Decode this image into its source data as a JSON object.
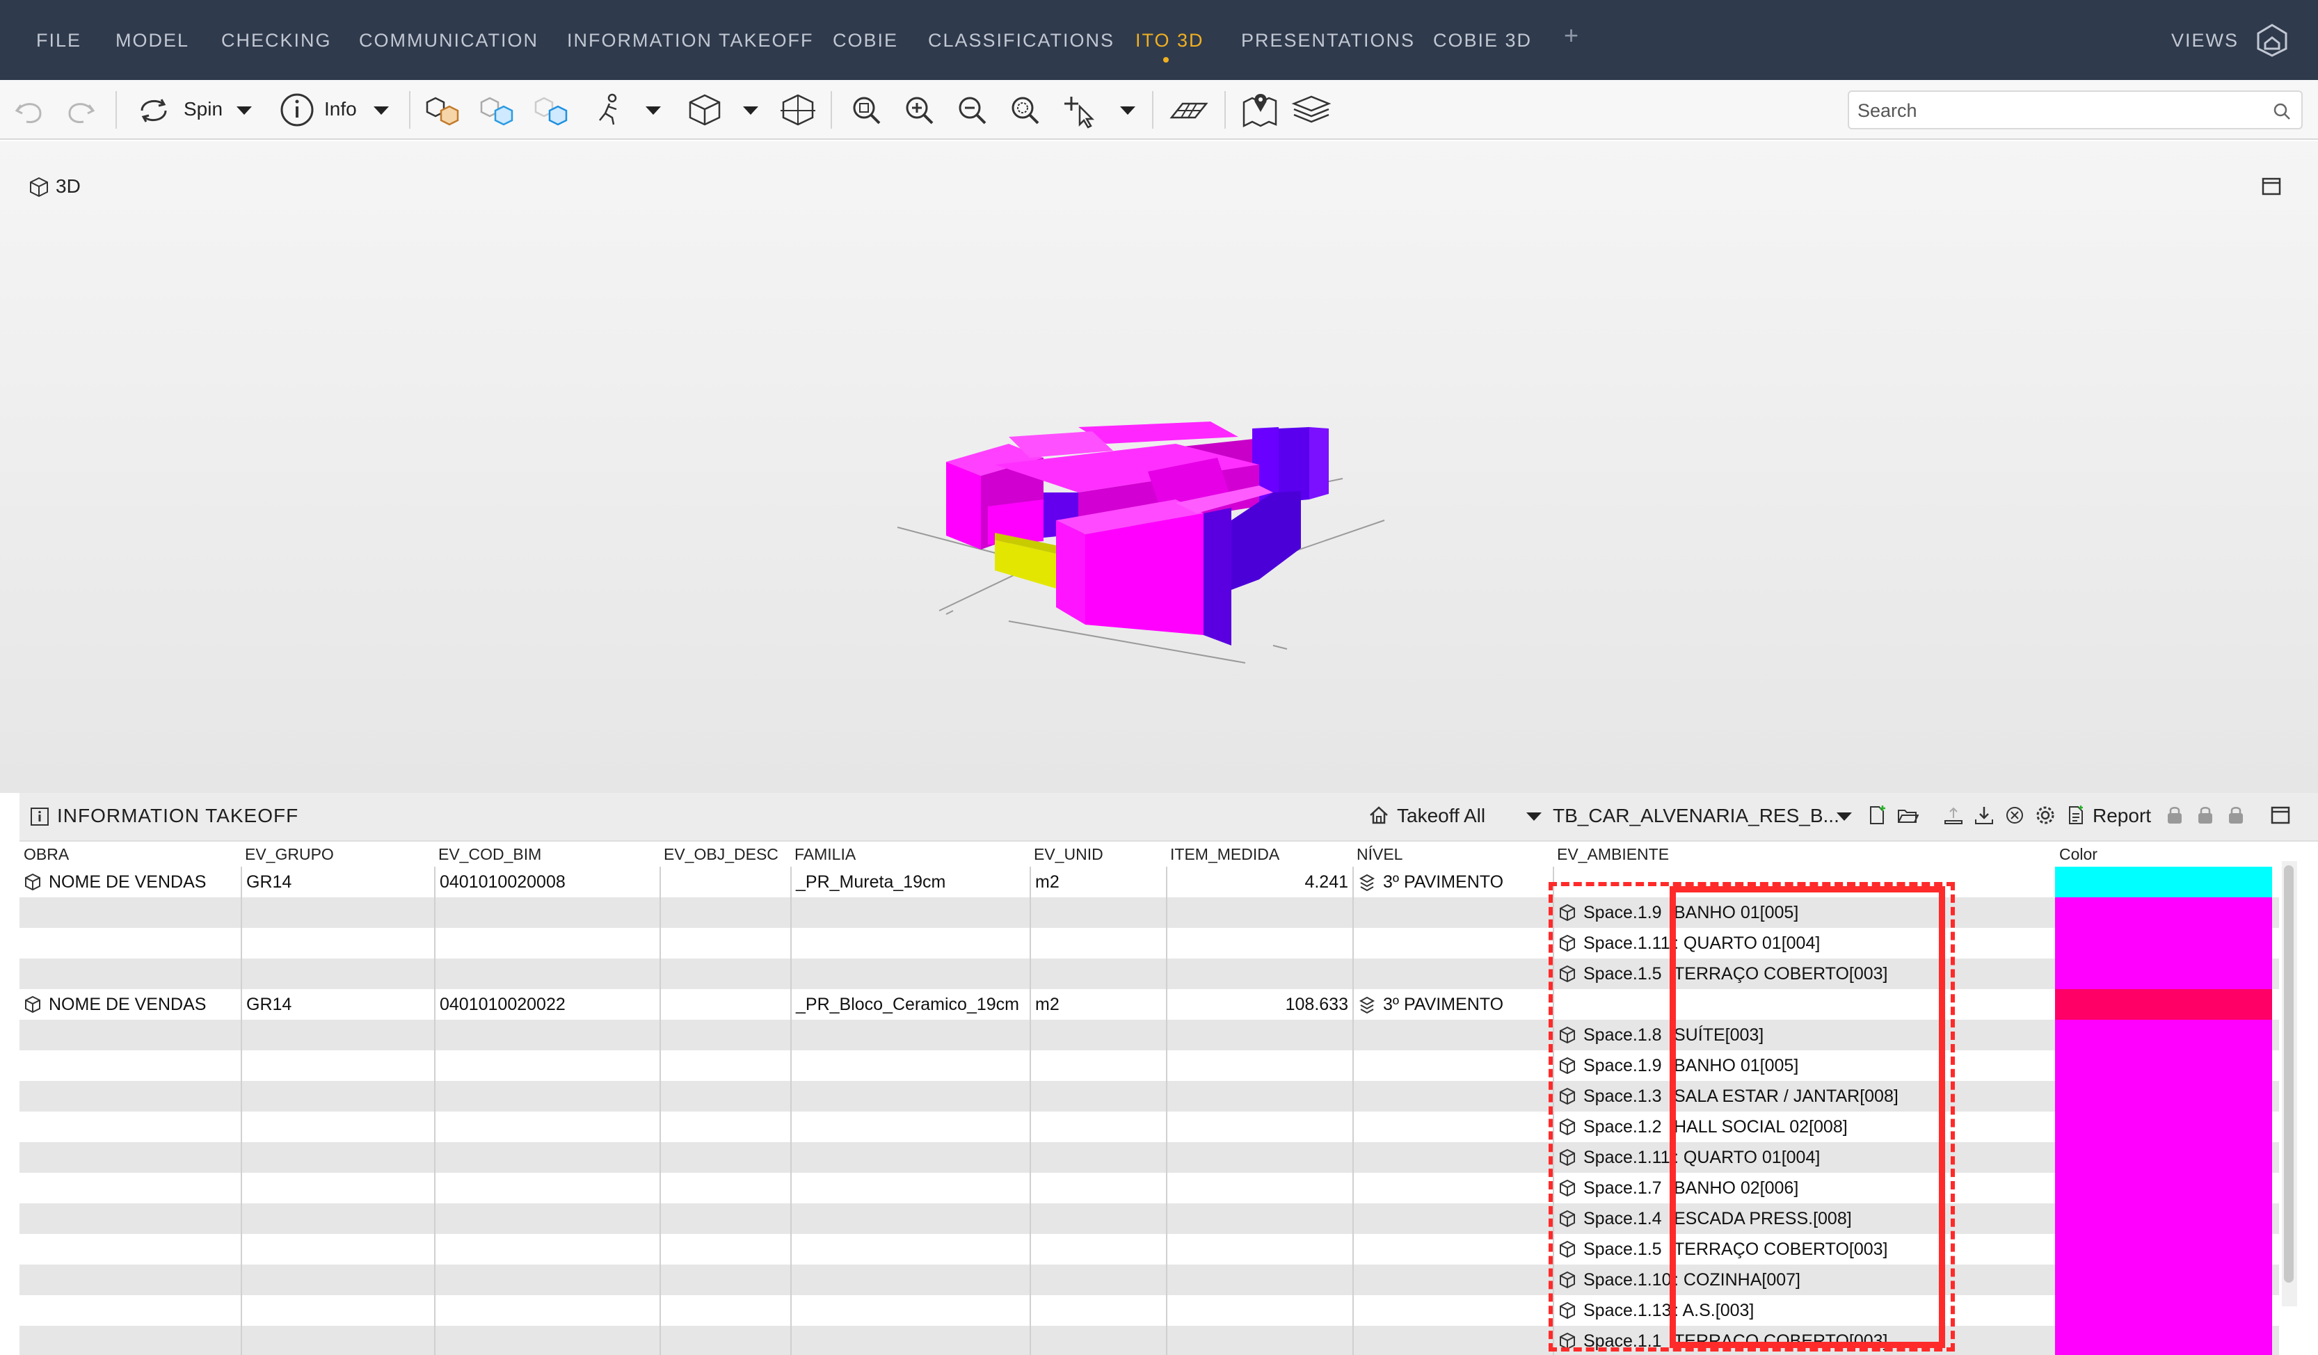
{
  "menu": {
    "items": [
      "FILE",
      "MODEL",
      "CHECKING",
      "COMMUNICATION",
      "INFORMATION TAKEOFF",
      "COBIE",
      "CLASSIFICATIONS",
      "ITO 3D",
      "PRESENTATIONS",
      "COBIE 3D"
    ],
    "active": "ITO 3D",
    "plus": "+",
    "views": "VIEWS"
  },
  "toolbar": {
    "spin_label": "Spin",
    "info_label": "Info",
    "search_placeholder": "Search"
  },
  "viewport": {
    "title": "3D"
  },
  "panel": {
    "title": "INFORMATION TAKEOFF",
    "takeoff_all": "Takeoff All",
    "template_name": "TB_CAR_ALVENARIA_RES_B...",
    "report_label": "Report"
  },
  "table": {
    "headers": [
      "OBRA",
      "EV_GRUPO",
      "EV_COD_BIM",
      "EV_OBJ_DESC",
      "FAMILIA",
      "EV_UNID",
      "ITEM_MEDIDA",
      "NÍVEL",
      "EV_AMBIENTE",
      "Color"
    ],
    "rows": [
      {
        "obra": "NOME DE VENDAS",
        "grupo": "GR14",
        "cod": "0401010020008",
        "desc": "",
        "familia": "_PR_Mureta_19cm",
        "unid": "m2",
        "medida": "4.241",
        "nivel": "3º PAVIMENTO",
        "space": "",
        "ambiente": "",
        "color": "#00ffff"
      },
      {
        "obra": "",
        "grupo": "",
        "cod": "",
        "desc": "",
        "familia": "",
        "unid": "",
        "medida": "",
        "nivel": "",
        "space": "Space.1.9",
        "ambiente": "BANHO 01[005]",
        "color": "#ff00ff"
      },
      {
        "obra": "",
        "grupo": "",
        "cod": "",
        "desc": "",
        "familia": "",
        "unid": "",
        "medida": "",
        "nivel": "",
        "space": "Space.1.11",
        "ambiente": ": QUARTO 01[004]",
        "color": "#ff00ff"
      },
      {
        "obra": "",
        "grupo": "",
        "cod": "",
        "desc": "",
        "familia": "",
        "unid": "",
        "medida": "",
        "nivel": "",
        "space": "Space.1.5",
        "ambiente": "TERRAÇO COBERTO[003]",
        "color": "#ff00ff"
      },
      {
        "obra": "NOME DE VENDAS",
        "grupo": "GR14",
        "cod": "0401010020022",
        "desc": "",
        "familia": "_PR_Bloco_Ceramico_19cm",
        "unid": "m2",
        "medida": "108.633",
        "nivel": "3º PAVIMENTO",
        "space": "",
        "ambiente": "",
        "color": "#ff0066"
      },
      {
        "obra": "",
        "grupo": "",
        "cod": "",
        "desc": "",
        "familia": "",
        "unid": "",
        "medida": "",
        "nivel": "",
        "space": "Space.1.8",
        "ambiente": "SUÍTE[003]",
        "color": "#ff00ff"
      },
      {
        "obra": "",
        "grupo": "",
        "cod": "",
        "desc": "",
        "familia": "",
        "unid": "",
        "medida": "",
        "nivel": "",
        "space": "Space.1.9",
        "ambiente": "BANHO 01[005]",
        "color": "#ff00ff"
      },
      {
        "obra": "",
        "grupo": "",
        "cod": "",
        "desc": "",
        "familia": "",
        "unid": "",
        "medida": "",
        "nivel": "",
        "space": "Space.1.3",
        "ambiente": "SALA ESTAR / JANTAR[008]",
        "color": "#ff00ff"
      },
      {
        "obra": "",
        "grupo": "",
        "cod": "",
        "desc": "",
        "familia": "",
        "unid": "",
        "medida": "",
        "nivel": "",
        "space": "Space.1.2",
        "ambiente": "HALL SOCIAL 02[008]",
        "color": "#ff00ff"
      },
      {
        "obra": "",
        "grupo": "",
        "cod": "",
        "desc": "",
        "familia": "",
        "unid": "",
        "medida": "",
        "nivel": "",
        "space": "Space.1.11",
        "ambiente": ": QUARTO 01[004]",
        "color": "#ff00ff"
      },
      {
        "obra": "",
        "grupo": "",
        "cod": "",
        "desc": "",
        "familia": "",
        "unid": "",
        "medida": "",
        "nivel": "",
        "space": "Space.1.7",
        "ambiente": "BANHO 02[006]",
        "color": "#ff00ff"
      },
      {
        "obra": "",
        "grupo": "",
        "cod": "",
        "desc": "",
        "familia": "",
        "unid": "",
        "medida": "",
        "nivel": "",
        "space": "Space.1.4",
        "ambiente": "ESCADA PRESS.[008]",
        "color": "#ff00ff"
      },
      {
        "obra": "",
        "grupo": "",
        "cod": "",
        "desc": "",
        "familia": "",
        "unid": "",
        "medida": "",
        "nivel": "",
        "space": "Space.1.5",
        "ambiente": "TERRAÇO COBERTO[003]",
        "color": "#ff00ff"
      },
      {
        "obra": "",
        "grupo": "",
        "cod": "",
        "desc": "",
        "familia": "",
        "unid": "",
        "medida": "",
        "nivel": "",
        "space": "Space.1.10",
        "ambiente": ": COZINHA[007]",
        "color": "#ff00ff"
      },
      {
        "obra": "",
        "grupo": "",
        "cod": "",
        "desc": "",
        "familia": "",
        "unid": "",
        "medida": "",
        "nivel": "",
        "space": "Space.1.13",
        "ambiente": ": A.S.[003]",
        "color": "#ff00ff"
      },
      {
        "obra": "",
        "grupo": "",
        "cod": "",
        "desc": "",
        "familia": "",
        "unid": "",
        "medida": "",
        "nivel": "",
        "space": "Space.1.1",
        "ambiente": "TERRAÇO COBERTO[003]",
        "color": "#ff00ff"
      }
    ]
  },
  "colors": {
    "menubar_bg": "#2f3a4c",
    "active_tab": "#f0b020",
    "annotation": "#ff2a2a",
    "model_magenta": "#ff00ff",
    "model_violet": "#6a00ff",
    "model_yellow": "#e3e600"
  }
}
